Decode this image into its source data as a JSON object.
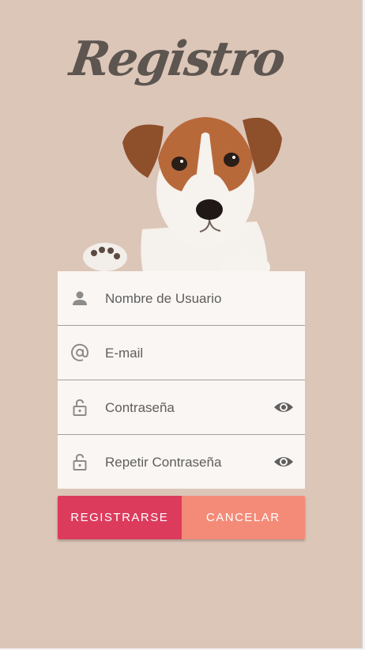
{
  "title": "Registro",
  "fields": [
    {
      "placeholder": "Nombre de Usuario",
      "icon": "person-icon"
    },
    {
      "placeholder": "E-mail",
      "icon": "at-icon"
    },
    {
      "placeholder": "Contraseña",
      "icon": "lock-icon"
    },
    {
      "placeholder": "Repetir Contraseña",
      "icon": "lock-icon"
    }
  ],
  "buttons": {
    "register_label": "REGISTRARSE",
    "cancel_label": "CANCELAR"
  },
  "colors": {
    "background": "#dcc6b8",
    "form": "#faf6f3",
    "primary": "#dc3b5c",
    "secondary": "#f48b78",
    "title": "#5d5550"
  }
}
